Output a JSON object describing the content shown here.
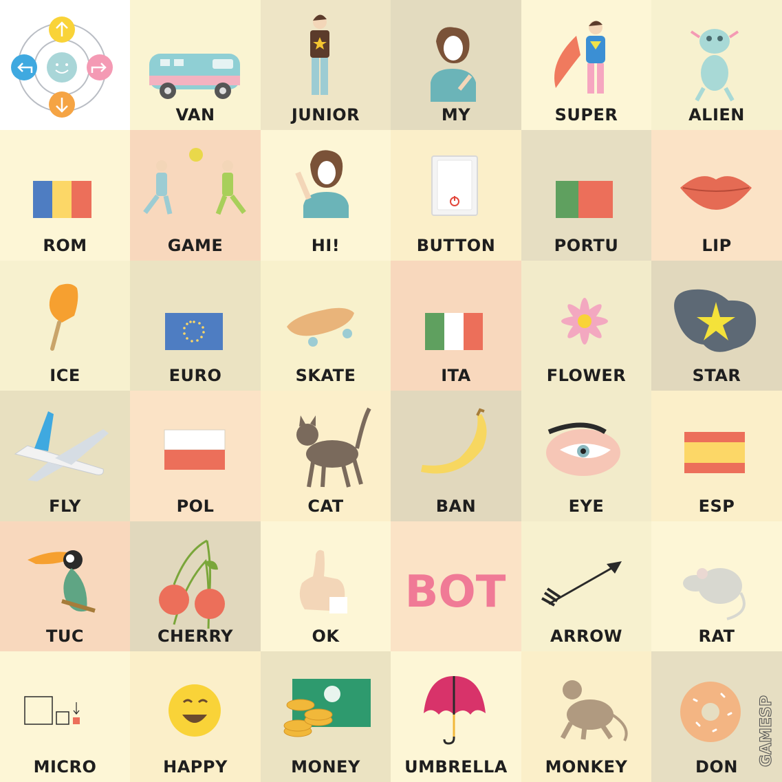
{
  "colors": {
    "cream": "#fdf6d2",
    "sand": "#ebe3c1",
    "peach": "#f7d9bf",
    "pale": "#fbefc9",
    "taupe": "#e2dac0",
    "text": "#1e1e1e"
  },
  "controller": {
    "up": "up-arrow-icon",
    "down": "down-arrow-icon",
    "left": "left-turn-icon",
    "right": "right-turn-icon",
    "center": "smiley-icon"
  },
  "cells": [
    {
      "label": "VAN",
      "icon": "van-icon",
      "bg": "#faf4d2"
    },
    {
      "label": "JUNIOR",
      "icon": "boy-icon",
      "bg": "#eee5c6"
    },
    {
      "label": "MY",
      "icon": "person-pointing-self-icon",
      "bg": "#e3dbbf"
    },
    {
      "label": "SUPER",
      "icon": "superhero-icon",
      "bg": "#fdf6d6"
    },
    {
      "label": "ALIEN",
      "icon": "alien-icon",
      "bg": "#f7f1cf"
    },
    {
      "label": "ROM",
      "icon": "romania-flag-icon",
      "bg": "#fdf6d6"
    },
    {
      "label": "GAME",
      "icon": "kids-playing-ball-icon",
      "bg": "#f8d8bd"
    },
    {
      "label": "HI!",
      "icon": "waving-person-icon",
      "bg": "#fdf6d6"
    },
    {
      "label": "BUTTON",
      "icon": "power-switch-icon",
      "bg": "#fbefc9"
    },
    {
      "label": "PORTU",
      "icon": "portugal-flag-icon",
      "bg": "#e6dec2"
    },
    {
      "label": "LIP",
      "icon": "lips-icon",
      "bg": "#fbe3c6"
    },
    {
      "label": "ICE",
      "icon": "popsicle-icon",
      "bg": "#f7f1cf"
    },
    {
      "label": "EURO",
      "icon": "eu-flag-icon",
      "bg": "#ebe3c2"
    },
    {
      "label": "SKATE",
      "icon": "skateboard-icon",
      "bg": "#f8f1cc"
    },
    {
      "label": "ITA",
      "icon": "italy-flag-icon",
      "bg": "#f8d8bd"
    },
    {
      "label": "FLOWER",
      "icon": "flower-icon",
      "bg": "#f2ebca"
    },
    {
      "label": "STAR",
      "icon": "star-burst-icon",
      "bg": "#e1d8bd"
    },
    {
      "label": "FLY",
      "icon": "airplane-icon",
      "bg": "#e8e0c0"
    },
    {
      "label": "POL",
      "icon": "poland-flag-icon",
      "bg": "#fbe3c6"
    },
    {
      "label": "CAT",
      "icon": "cat-icon",
      "bg": "#fcefca"
    },
    {
      "label": "BAN",
      "icon": "banana-icon",
      "bg": "#e1d8bd"
    },
    {
      "label": "EYE",
      "icon": "eye-icon",
      "bg": "#f2ebca"
    },
    {
      "label": "ESP",
      "icon": "spain-flag-icon",
      "bg": "#fbefc9"
    },
    {
      "label": "TUC",
      "icon": "toucan-icon",
      "bg": "#f8d8bd"
    },
    {
      "label": "CHERRY",
      "icon": "cherry-icon",
      "bg": "#e1d8bd"
    },
    {
      "label": "OK",
      "icon": "thumbs-up-icon",
      "bg": "#fdf6d6"
    },
    {
      "label": "",
      "word": "BOT",
      "icon": "bot-word-icon",
      "bg": "#fbe3c6"
    },
    {
      "label": "ARROW",
      "icon": "arrow-icon",
      "bg": "#f7f1cf"
    },
    {
      "label": "RAT",
      "icon": "rat-icon",
      "bg": "#fdf6d6"
    },
    {
      "label": "MICRO",
      "icon": "micro-squares-icon",
      "bg": "#fdf6d6"
    },
    {
      "label": "HAPPY",
      "icon": "happy-face-icon",
      "bg": "#fbefc9"
    },
    {
      "label": "MONEY",
      "icon": "money-icon",
      "bg": "#ebe3c2"
    },
    {
      "label": "UMBRELLA",
      "icon": "umbrella-icon",
      "bg": "#fdf6d6"
    },
    {
      "label": "MONKEY",
      "icon": "monkey-icon",
      "bg": "#fbefc9"
    },
    {
      "label": "DON",
      "icon": "donut-icon",
      "bg": "#e6dec2"
    }
  ],
  "brand": "GAMESP"
}
